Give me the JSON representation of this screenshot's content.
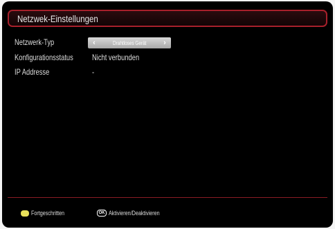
{
  "header": {
    "title": "Netzwek-Einstellungen"
  },
  "settings": [
    {
      "label": "Netzwerk-Typ",
      "value": "Drahtloses Gerät"
    },
    {
      "label": "Konfigurationsstatus",
      "value": "Nicht verbunden"
    },
    {
      "label": "IP Addresse",
      "value": "-"
    }
  ],
  "selector": {
    "left_icon": "chevron-left-icon",
    "right_icon": "chevron-right-icon",
    "left_glyph": "‹",
    "right_glyph": "›"
  },
  "footer": {
    "advanced_label": "Fortgeschritten",
    "advanced_button_color": "#e8e05a",
    "ok_key": "OK",
    "toggle_label": "Aktivieren/Deaktivieren"
  },
  "colors": {
    "accent": "#a8202b",
    "background": "#000000"
  }
}
